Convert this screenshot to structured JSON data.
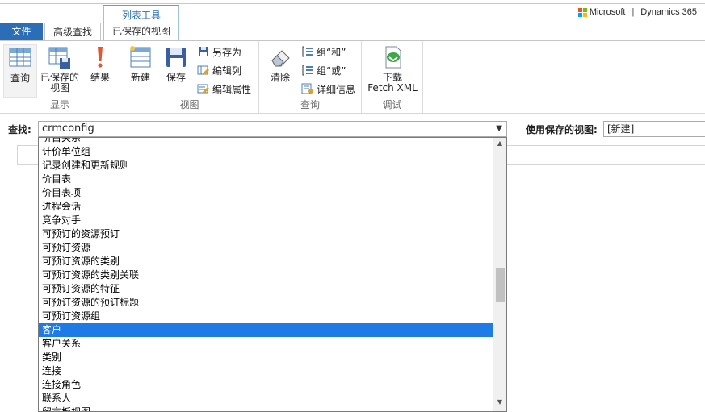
{
  "brand": {
    "company": "Microsoft",
    "product": "Dynamics 365"
  },
  "tabs": {
    "file": "文件",
    "advanced_find": "高级查找",
    "context_group": "列表工具",
    "saved_views": "已保存的视图"
  },
  "ribbon": {
    "display": {
      "label": "显示",
      "query": "查询",
      "saved_views": "已保存的视图",
      "results": "结果"
    },
    "view": {
      "label": "视图",
      "new": "新建",
      "save": "保存",
      "save_as": "另存为",
      "edit_columns": "编辑列",
      "edit_properties": "编辑属性"
    },
    "query": {
      "label": "查询",
      "clear": "清除",
      "group_and": "组“和”",
      "group_or": "组“或”",
      "details": "详细信息"
    },
    "debug": {
      "label": "调试",
      "download": "下载",
      "fetch_xml": "Fetch XML"
    }
  },
  "find": {
    "label": "查找:",
    "value": "crmconfig",
    "view_label": "使用保存的视图:",
    "view_value": "[新建]"
  },
  "dropdown": {
    "items": [
      "价目关系",
      "计价单位组",
      "记录创建和更新规则",
      "价目表",
      "价目表项",
      "进程会话",
      "竞争对手",
      "可预订的资源预订",
      "可预订资源",
      "可预订资源的类别",
      "可预订资源的类别关联",
      "可预订资源的特征",
      "可预订资源的预订标题",
      "可预订资源组",
      "客户",
      "客户关系",
      "类别",
      "连接",
      "连接角色",
      "联系人",
      "留言板视图"
    ],
    "selected": "客户"
  },
  "icons": {
    "up": "triangle-up",
    "down": "triangle-down",
    "select": "chevron-down"
  },
  "colors": {
    "accent": "#2b6db6",
    "selection": "#1e7ae6"
  }
}
